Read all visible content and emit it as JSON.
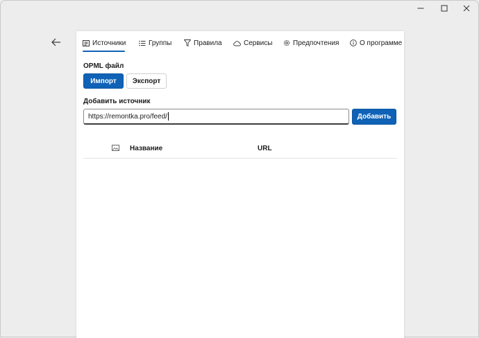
{
  "window": {
    "controls": [
      "minimize-icon",
      "maximize-icon",
      "close-icon"
    ]
  },
  "nav": {
    "back_icon": "arrow-left-icon"
  },
  "tabs": [
    {
      "label": "Источники",
      "icon": "news-icon",
      "selected": true
    },
    {
      "label": "Группы",
      "icon": "list-icon",
      "selected": false
    },
    {
      "label": "Правила",
      "icon": "filter-icon",
      "selected": false
    },
    {
      "label": "Сервисы",
      "icon": "cloud-icon",
      "selected": false
    },
    {
      "label": "Предпочтения",
      "icon": "gear-icon",
      "selected": false
    },
    {
      "label": "О программе",
      "icon": "info-icon",
      "selected": false
    }
  ],
  "opml": {
    "title": "OPML файл",
    "import_label": "Импорт",
    "export_label": "Экспорт"
  },
  "add_source": {
    "title": "Добавить источник",
    "input_value": "https://remontka.pro/feed/",
    "add_label": "Добавить"
  },
  "table": {
    "icon": "image-icon",
    "columns": [
      "Название",
      "URL"
    ],
    "rows": []
  },
  "colors": {
    "accent": "#0f62b6",
    "window_bg": "#ededed",
    "panel_bg": "#ffffff"
  }
}
